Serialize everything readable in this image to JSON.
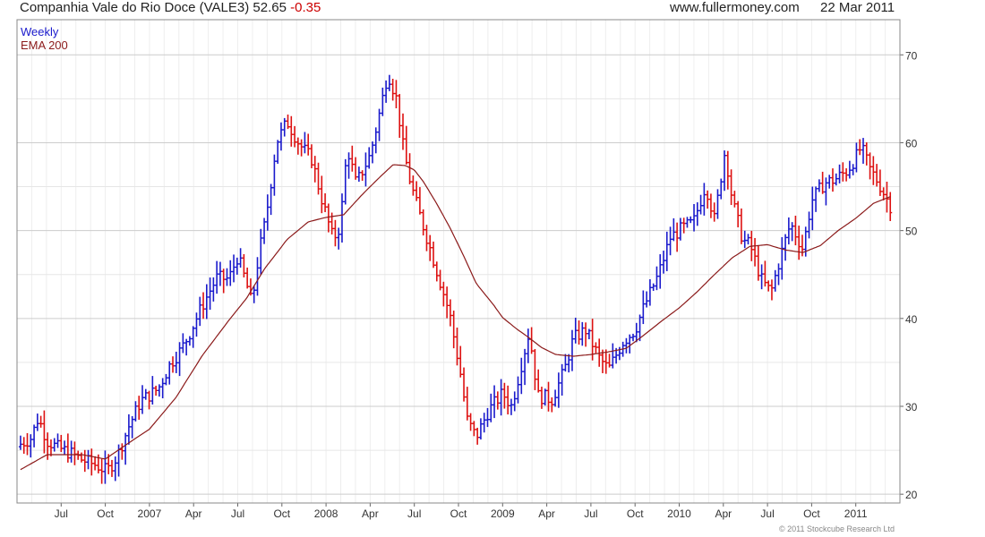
{
  "header": {
    "title": "Companhia Vale do Rio Doce (VALE3) 52.65",
    "change": "-0.35",
    "site": "www.fullermoney.com",
    "date": "22 Mar 2011"
  },
  "copyright": "© 2011 Stockcube Research Ltd",
  "colors": {
    "up": "#1a1acc",
    "down": "#dd1111",
    "ema": "#8b1a1a",
    "grid": "#dddddd",
    "bg": "#ffffff"
  },
  "chart_data": {
    "type": "line",
    "subtype": "candlestick-ohlc",
    "legend": [
      {
        "label": "Weekly",
        "color": "#1a1acc"
      },
      {
        "label": "EMA 200",
        "color": "#8b1a1a"
      }
    ],
    "legend_position": "top-left",
    "x_tick_labels": [
      "Jul",
      "Oct",
      "2007",
      "Apr",
      "Jul",
      "Oct",
      "2008",
      "Apr",
      "Jul",
      "Oct",
      "2009",
      "Apr",
      "Jul",
      "Oct",
      "2010",
      "Apr",
      "Jul",
      "Oct",
      "2011"
    ],
    "x_tick_months": [
      2006.5,
      2006.75,
      2007.0,
      2007.25,
      2007.5,
      2007.75,
      2008.0,
      2008.25,
      2008.5,
      2008.75,
      2009.0,
      2009.25,
      2009.5,
      2009.75,
      2010.0,
      2010.25,
      2010.5,
      2010.75,
      2011.0
    ],
    "x_range": [
      2006.25,
      2011.25
    ],
    "y_ticks": [
      20,
      30,
      40,
      50,
      60,
      70
    ],
    "y_range": [
      19,
      74
    ],
    "y_axis_side": "right",
    "grid": true,
    "price_anchors": {
      "x": [
        2006.27,
        2006.33,
        2006.37,
        2006.42,
        2006.47,
        2006.55,
        2006.62,
        2006.7,
        2006.76,
        2006.82,
        2006.88,
        2006.95,
        2007.05,
        2007.12,
        2007.18,
        2007.22,
        2007.3,
        2007.38,
        2007.45,
        2007.5,
        2007.55,
        2007.58,
        2007.62,
        2007.66,
        2007.72,
        2007.78,
        2007.85,
        2007.92,
        2007.97,
        2008.04,
        2008.08,
        2008.12,
        2008.17,
        2008.25,
        2008.3,
        2008.35,
        2008.4,
        2008.44,
        2008.48,
        2008.52,
        2008.58,
        2008.64,
        2008.7,
        2008.76,
        2008.8,
        2008.85,
        2008.92,
        2009.0,
        2009.05,
        2009.1,
        2009.15,
        2009.2,
        2009.28,
        2009.35,
        2009.4,
        2009.47,
        2009.55,
        2009.6,
        2009.68,
        2009.75,
        2009.8,
        2009.88,
        2009.95,
        2010.02,
        2010.08,
        2010.15,
        2010.2,
        2010.26,
        2010.3,
        2010.36,
        2010.4,
        2010.47,
        2010.52,
        2010.58,
        2010.63,
        2010.7,
        2010.75,
        2010.82,
        2010.88,
        2010.95,
        2011.0,
        2011.03,
        2011.08,
        2011.13,
        2011.2
      ],
      "close": [
        25.7,
        26.4,
        28.7,
        26.1,
        25.4,
        24.7,
        23.9,
        23.3,
        22.6,
        24.4,
        27.6,
        30.6,
        32.0,
        34.9,
        36.5,
        38.0,
        41.5,
        44.6,
        44.5,
        47.1,
        43.9,
        41.6,
        47.4,
        51.5,
        60.1,
        62.4,
        59.8,
        58.1,
        54.0,
        49.0,
        50.5,
        59.5,
        55.3,
        58.6,
        63.1,
        68.0,
        64.9,
        59.0,
        55.3,
        52.5,
        48.6,
        44.6,
        40.5,
        33.9,
        28.4,
        26.5,
        29.5,
        31.5,
        30.0,
        34.2,
        38.5,
        31.2,
        30.8,
        34.1,
        37.7,
        38.7,
        35.4,
        34.2,
        37.3,
        38.7,
        41.3,
        44.9,
        49.2,
        50.3,
        50.9,
        55.2,
        51.2,
        59.2,
        53.5,
        48.9,
        48.4,
        44.2,
        43.0,
        47.5,
        50.8,
        47.9,
        53.4,
        55.4,
        55.8,
        56.8,
        58.3,
        59.5,
        57.0,
        55.4,
        52.65
      ]
    },
    "ema200_anchors": {
      "x": [
        2006.27,
        2006.42,
        2006.62,
        2006.75,
        2006.88,
        2007.0,
        2007.15,
        2007.3,
        2007.45,
        2007.55,
        2007.65,
        2007.78,
        2007.9,
        2008.0,
        2008.1,
        2008.2,
        2008.3,
        2008.38,
        2008.45,
        2008.5,
        2008.55,
        2008.62,
        2008.7,
        2008.78,
        2008.85,
        2008.95,
        2009.0,
        2009.08,
        2009.15,
        2009.22,
        2009.3,
        2009.4,
        2009.5,
        2009.6,
        2009.7,
        2009.8,
        2009.9,
        2010.0,
        2010.1,
        2010.2,
        2010.3,
        2010.4,
        2010.5,
        2010.6,
        2010.7,
        2010.8,
        2010.9,
        2011.0,
        2011.1,
        2011.2
      ],
      "value": [
        22.8,
        24.5,
        24.5,
        24.0,
        25.8,
        27.4,
        31.0,
        35.8,
        39.8,
        42.3,
        45.6,
        49.0,
        51.0,
        51.5,
        51.8,
        54.0,
        56.0,
        57.5,
        57.4,
        56.9,
        55.6,
        53.3,
        50.4,
        47.1,
        44.0,
        41.5,
        40.1,
        38.8,
        37.8,
        36.7,
        35.9,
        35.7,
        35.9,
        36.2,
        36.6,
        38.1,
        39.7,
        41.2,
        43.0,
        45.0,
        46.9,
        48.2,
        48.4,
        47.8,
        47.5,
        48.3,
        50.0,
        51.4,
        53.1,
        53.9
      ]
    },
    "notable_points": {
      "high_2008": 72.5,
      "low_2008": 22.3,
      "last_close": 52.65
    }
  }
}
